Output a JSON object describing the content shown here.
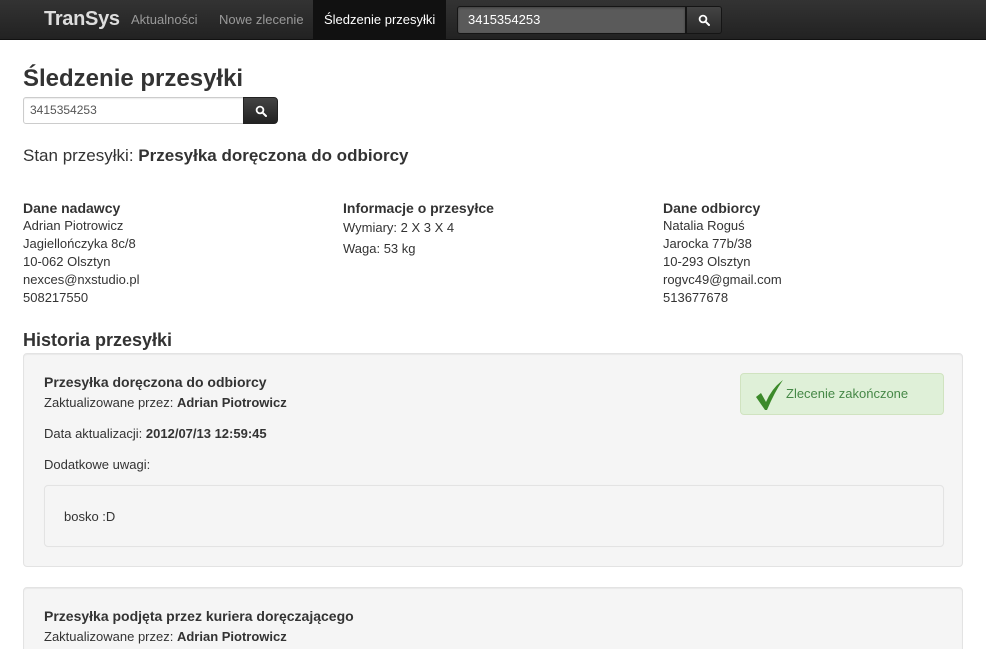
{
  "navbar": {
    "brand": "TranSys",
    "links": [
      "Aktualności",
      "Nowe zlecenie",
      "Śledzenie przesyłki"
    ],
    "active_index": 2,
    "search_value": "3415354253",
    "search_icon": "search-icon"
  },
  "page": {
    "title": "Śledzenie przesyłki",
    "search_value": "3415354253",
    "status_label": "Stan przesyłki:",
    "status_value": "Przesyłka doręczona do odbiorcy"
  },
  "sender": {
    "title": "Dane nadawcy",
    "name": "Adrian Piotrowicz",
    "street": "Jagiellończyka 8c/8",
    "city": "10-062 Olsztyn",
    "email": "nexces@nxstudio.pl",
    "phone": "508217550"
  },
  "parcel": {
    "title": "Informacje o przesyłce",
    "dimensions": "Wymiary: 2 X 3 X 4",
    "weight": "Waga: 53 kg"
  },
  "recipient": {
    "title": "Dane odbiorcy",
    "name": "Natalia Roguś",
    "street": "Jarocka 77b/38",
    "city": "10-293 Olsztyn",
    "email": "rogvc49@gmail.com",
    "phone": "513677678"
  },
  "history": {
    "title": "Historia przesyłki",
    "entries": [
      {
        "title": "Przesyłka doręczona do odbiorcy",
        "updated_by_label": "Zaktualizowane przez:",
        "updated_by": "Adrian Piotrowicz",
        "date_label": "Data aktualizacji:",
        "date": "2012/07/13 12:59:45",
        "notes_label": "Dodatkowe uwagi:",
        "notes": "bosko :D",
        "badge": "Zlecenie zakończone",
        "badge_icon": "checkmark-icon"
      },
      {
        "title": "Przesyłka podjęta przez kuriera doręczającego",
        "updated_by_label": "Zaktualizowane przez:",
        "updated_by": "Adrian Piotrowicz"
      }
    ]
  },
  "colors": {
    "navbar_bg": "#222222",
    "success_bg": "#dff0d8",
    "success_text": "#468847",
    "check_green": "#3c8a2a"
  }
}
